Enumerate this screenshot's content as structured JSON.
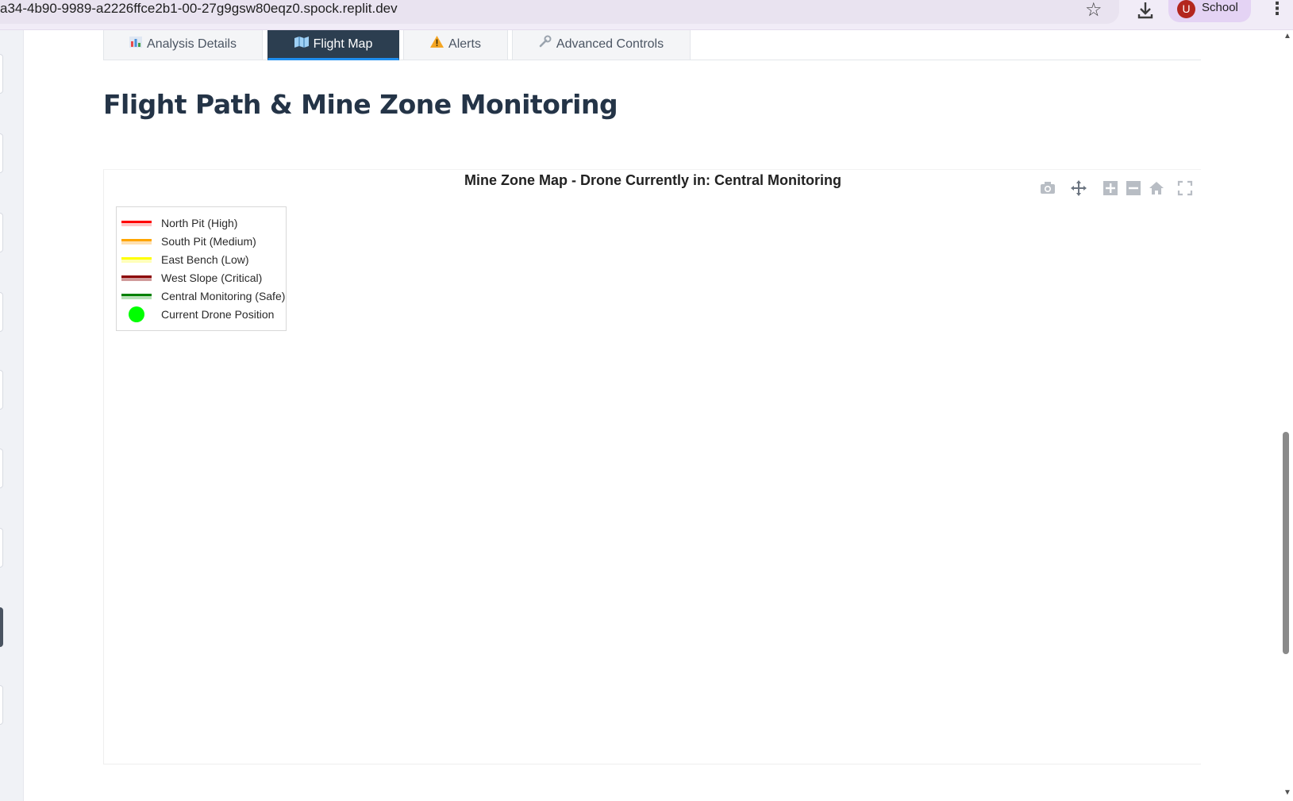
{
  "browser": {
    "url": "a34-4b90-9989-a2226ffce2b1-00-27g9gsw80eqz0.spock.replit.dev",
    "profile_initial": "U",
    "profile_name": "School"
  },
  "tabs": [
    {
      "label": "Analysis Details",
      "icon": "bar-chart-icon"
    },
    {
      "label": "Flight Map",
      "icon": "map-icon",
      "active": true
    },
    {
      "label": "Alerts",
      "icon": "warning-icon"
    },
    {
      "label": "Advanced Controls",
      "icon": "wrench-icon"
    }
  ],
  "page_title": "Flight Path & Mine Zone Monitoring",
  "chart": {
    "title": "Mine Zone Map - Drone Currently in: Central Monitoring",
    "modebar": [
      "camera-icon",
      "pan-icon",
      "zoom-in-icon",
      "zoom-out-icon",
      "home-icon",
      "fullscreen-icon"
    ],
    "legend": [
      {
        "label": "North Pit (High)",
        "color": "#ff0000",
        "fill": "#ffc8c8",
        "kind": "line"
      },
      {
        "label": "South Pit (Medium)",
        "color": "#ffa500",
        "fill": "#ffe0b0",
        "kind": "line"
      },
      {
        "label": "East Bench (Low)",
        "color": "#ffff00",
        "fill": "#ffffb8",
        "kind": "line"
      },
      {
        "label": "West Slope (Critical)",
        "color": "#8b0000",
        "fill": "#d09a9a",
        "kind": "line"
      },
      {
        "label": "Central Monitoring (Safe)",
        "color": "#008000",
        "fill": "#b8e0b8",
        "kind": "line"
      },
      {
        "label": "Current Drone Position",
        "color": "#00ff00",
        "kind": "marker"
      }
    ]
  },
  "chart_data": {
    "type": "scatter",
    "title": "Mine Zone Map - Drone Currently in: Central Monitoring",
    "legend_placement": "top-left",
    "series": [
      {
        "name": "North Pit (High)",
        "x": [],
        "y": []
      },
      {
        "name": "South Pit (Medium)",
        "x": [],
        "y": []
      },
      {
        "name": "East Bench (Low)",
        "x": [],
        "y": []
      },
      {
        "name": "West Slope (Critical)",
        "x": [],
        "y": []
      },
      {
        "name": "Central Monitoring (Safe)",
        "x": [],
        "y": []
      },
      {
        "name": "Current Drone Position",
        "x": [],
        "y": []
      }
    ],
    "grid": false
  }
}
